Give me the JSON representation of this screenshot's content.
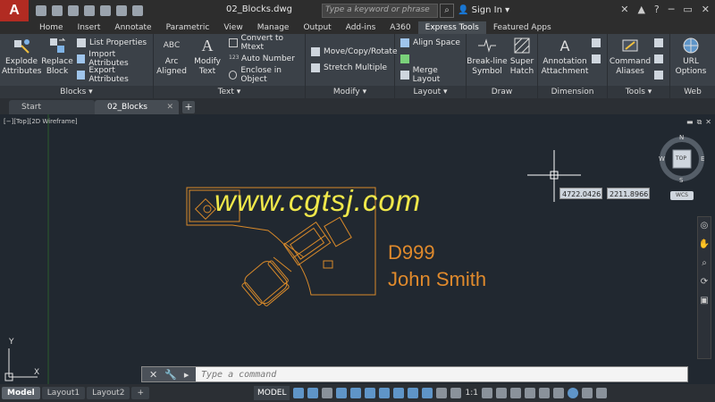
{
  "app": {
    "logo_letter": "A"
  },
  "titlebar": {
    "document_title": "02_Blocks.dwg",
    "search_placeholder": "Type a keyword or phrase",
    "sign_in": "Sign In"
  },
  "ribbon_tabs": [
    "Home",
    "Insert",
    "Annotate",
    "Parametric",
    "View",
    "Manage",
    "Output",
    "Add-ins",
    "A360",
    "Express Tools",
    "Featured Apps"
  ],
  "active_tab": "Express Tools",
  "ribbon": {
    "blocks": {
      "label": "Blocks",
      "explode_attributes": "Explode\nAttributes",
      "replace_block": "Replace\nBlock",
      "list_properties": "List Properties",
      "import_attributes": "Import Attributes",
      "export_attributes": "Export Attributes"
    },
    "text": {
      "label": "Text",
      "arc_aligned": "Arc\nAligned",
      "modify_text": "Modify\nText",
      "convert_to_mtext": "Convert to Mtext",
      "auto_number": "Auto Number",
      "enclose_in_object": "Enclose in Object"
    },
    "modify": {
      "label": "Modify",
      "move_copy_rotate": "Move/Copy/Rotate",
      "stretch_multiple": "Stretch Multiple"
    },
    "layout": {
      "label": "Layout",
      "align_space": "Align Space",
      "merge_layout": "Merge Layout"
    },
    "draw": {
      "label": "Draw",
      "break_line_symbol": "Break-line\nSymbol",
      "super_hatch": "Super\nHatch"
    },
    "dimension": {
      "label": "Dimension",
      "annotation_attachment": "Annotation\nAttachment"
    },
    "tools": {
      "label": "Tools",
      "command_aliases": "Command\nAliases"
    },
    "web": {
      "label": "Web",
      "url_options": "URL\nOptions"
    }
  },
  "doc_tabs": [
    {
      "label": "Start"
    },
    {
      "label": "02_Blocks",
      "active": true
    }
  ],
  "viewport": {
    "label": "[−][Top][2D Wireframe]",
    "watermark": "www.cgtsj.com",
    "block_label_1": "D999",
    "block_label_2": "John Smith",
    "coord_x": "4722.0426",
    "coord_y": "2211.8966",
    "viewcube": {
      "n": "N",
      "s": "S",
      "e": "E",
      "w": "W",
      "face": "TOP",
      "wcs": "WCS"
    },
    "ucs_y": "Y",
    "ucs_x": "X"
  },
  "command_line": {
    "placeholder": "Type a command"
  },
  "layout_tabs": [
    "Model",
    "Layout1",
    "Layout2"
  ],
  "status": {
    "model": "MODEL",
    "scale": "1:1"
  },
  "colors": {
    "accent_orange": "#e08a2c",
    "watermark_yellow": "#f0e84a",
    "background": "#212830"
  }
}
